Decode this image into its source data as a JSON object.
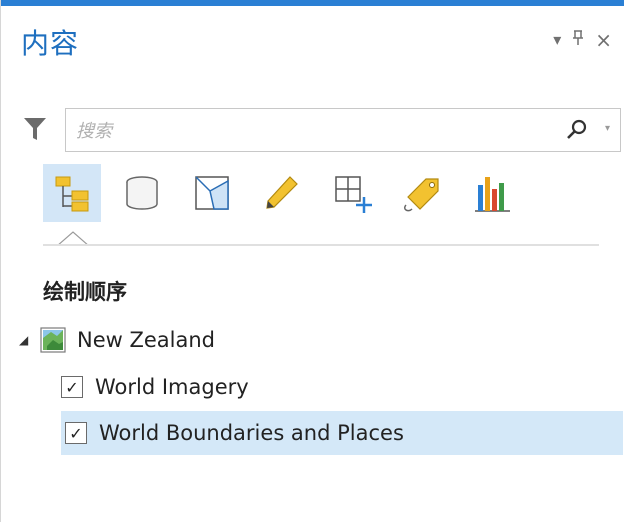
{
  "pane": {
    "title": "内容",
    "controls": {
      "menu_icon": "dropdown-icon",
      "pin_icon": "pin-icon",
      "close_icon": "close-icon"
    }
  },
  "search": {
    "placeholder": "搜索",
    "value": ""
  },
  "toolbar": {
    "tools": [
      {
        "name": "drawing-order-icon",
        "active": true
      },
      {
        "name": "data-source-icon",
        "active": false
      },
      {
        "name": "selection-icon",
        "active": false
      },
      {
        "name": "editing-icon",
        "active": false
      },
      {
        "name": "snapping-icon",
        "active": false
      },
      {
        "name": "labeling-icon",
        "active": false
      },
      {
        "name": "charts-icon",
        "active": false
      }
    ]
  },
  "section": {
    "title": "绘制顺序"
  },
  "tree": {
    "map": {
      "label": "New Zealand",
      "expanded": true
    },
    "layers": [
      {
        "label": "World Imagery",
        "checked": true,
        "selected": false
      },
      {
        "label": "World Boundaries and Places",
        "checked": true,
        "selected": true
      }
    ]
  },
  "colors": {
    "accent": "#2a7fd4",
    "title": "#1e6fbf",
    "selection": "#d4e8f8",
    "active_tool": "#d3e6f7"
  }
}
